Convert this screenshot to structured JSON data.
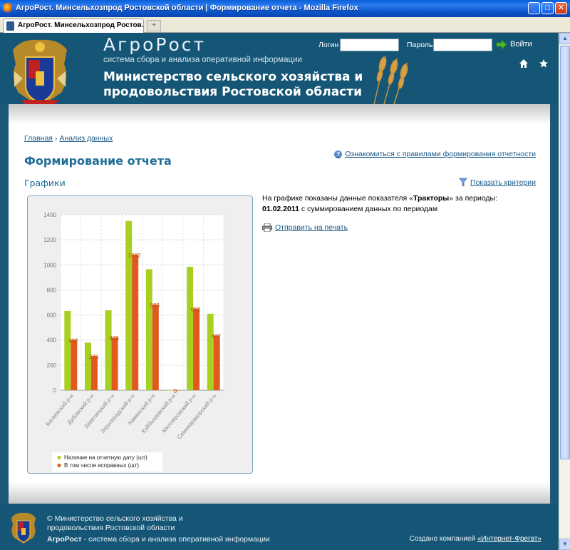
{
  "window": {
    "title": "АгроРост. Минсельхозпрод Ростовской области | Формирование отчета - Mozilla Firefox",
    "minimize": "_",
    "maximize": "□",
    "close": "✕"
  },
  "tabs": [
    {
      "label": "АгроРост. Минсельхозпрод Ростов..."
    }
  ],
  "newtab": "+",
  "header": {
    "brand": "АгроРост",
    "tagline": "система сбора и анализа оперативной информации",
    "ministry_line1": "Министерство сельского хозяйства и",
    "ministry_line2": "продовольствия Ростовской области",
    "login_label": "Логин",
    "password_label": "Пароль",
    "login_value": "",
    "password_value": "",
    "login_button": "Войти"
  },
  "breadcrumb": {
    "home": "Главная",
    "separator": "›",
    "current": "Анализ данных"
  },
  "page": {
    "title": "Формирование отчета",
    "rules_link": "Ознакомиться с правилами формирования отчетности",
    "section_title": "Графики",
    "criteria_link": "Показать критерии",
    "desc_part1": "На графике показаны данные показателя «",
    "desc_indicator": "Тракторы",
    "desc_part2": "» за периоды:",
    "desc_period": "01.02.2011",
    "desc_part3": " с суммированием данных по периодам",
    "print_link": "Отправить на печать"
  },
  "chart_data": {
    "type": "bar",
    "categories": [
      "Багаевский р-н",
      "Дубовский р-н",
      "Заветинский р-н",
      "Зерноградский р-н",
      "Каменский р-н",
      "Куйбышевский р-н",
      "Миллеровский р-н",
      "Семикаракорский р-н"
    ],
    "series": [
      {
        "name": "Наличие на отчетную дату (шт)",
        "color": "#a8d020",
        "values": [
          632,
          380,
          638,
          1350,
          965,
          0,
          985,
          610
        ]
      },
      {
        "name": "В том числе исправных (шт)",
        "color": "#e05a20",
        "values": [
          402,
          273,
          420,
          1082,
          683,
          0,
          652,
          437
        ]
      }
    ],
    "data_labels": [
      "402",
      "273",
      "420",
      "1082",
      "683",
      "0",
      "652",
      "437"
    ],
    "yticks": [
      "0",
      "200",
      "400",
      "600",
      "800",
      "1000",
      "1200",
      "1400"
    ],
    "ylim": [
      0,
      1400
    ],
    "grid": true,
    "legend_position": "bottom-left"
  },
  "footer": {
    "copyright_line1": "© Министерство сельского хозяйства и",
    "copyright_line2": "продовольствия Ростовской области",
    "system_brand": "АгроРост",
    "system_desc": " - система сбора и анализа оперативной информации",
    "created_text": "Создано компанией ",
    "created_link": "«Интернет-Фрегат»"
  }
}
